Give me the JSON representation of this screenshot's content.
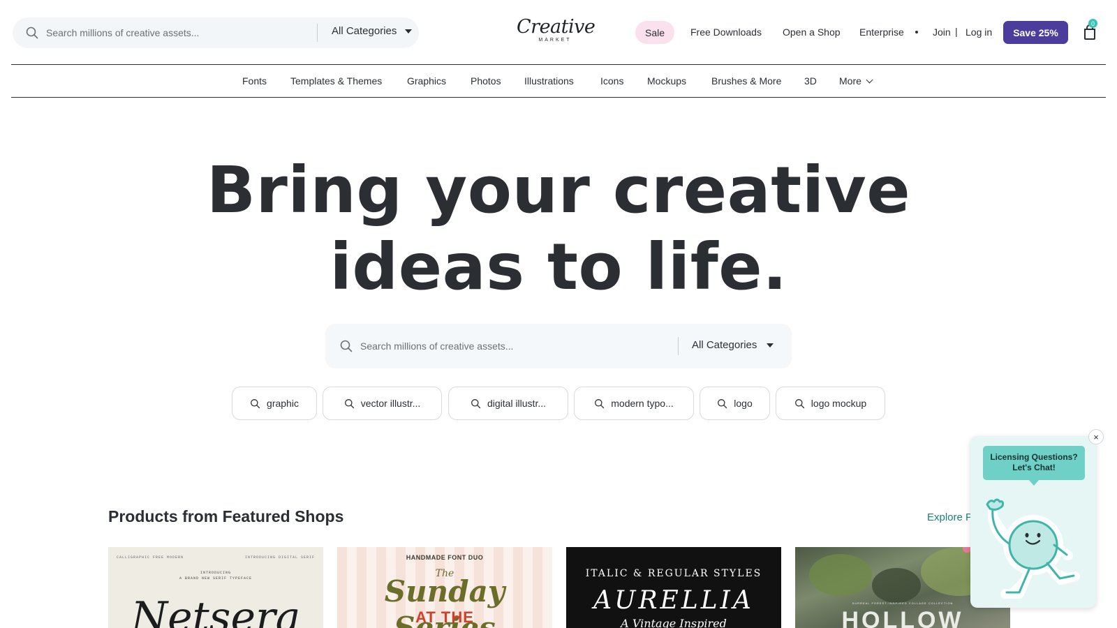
{
  "header": {
    "search_placeholder": "Search millions of creative assets...",
    "category_label": "All Categories",
    "logo_word": "Creative",
    "logo_sub": "MARKET",
    "sale": "Sale",
    "links": {
      "free_downloads": "Free Downloads",
      "open_shop": "Open a Shop",
      "enterprise": "Enterprise",
      "join": "Join",
      "separator": "|",
      "login": "Log in"
    },
    "save_button": "Save 25%",
    "cart_count": "0",
    "icons": [
      "search-icon",
      "caret-down-icon",
      "cart-icon"
    ]
  },
  "category_nav": {
    "items": [
      "Fonts",
      "Templates & Themes",
      "Graphics",
      "Photos",
      "Illustrations",
      "Icons",
      "Mockups",
      "Brushes & More",
      "3D",
      "More"
    ]
  },
  "hero": {
    "title_line1": "Bring your creative",
    "title_line2": "ideas to life.",
    "search_placeholder": "Search millions of creative assets...",
    "category_label": "All Categories",
    "chips": [
      "graphic",
      "vector illustr...",
      "digital illustr...",
      "modern typo...",
      "logo",
      "logo mockup"
    ]
  },
  "featured": {
    "title": "Products from Featured Shops",
    "explore_link": "Explore P",
    "cards": [
      {
        "small_left": "CALLIGRAPHIC FREE MODERN",
        "small_right": "INTRODUCING DIGITAL SERIF",
        "line1": "INTRODUCING",
        "line2": "A BRAND NEW SERIF TYPEFACE",
        "title": "Netsera"
      },
      {
        "top": "HANDMADE FONT DUO",
        "the": "The",
        "title": "Sunday Series",
        "sub": "AT THE"
      },
      {
        "top": "ITALIC & REGULAR STYLES",
        "title": "AURELLIA",
        "sub": "A Vintage Inspired"
      },
      {
        "small": "SURREAL FOREST-INSPIRED COLLAGE COLLECTION",
        "title": "HOLLOW"
      }
    ]
  },
  "chat": {
    "bubble_line1": "Licensing Questions?",
    "bubble_line2": "Let's Chat!",
    "close": "×"
  },
  "colors": {
    "brand_purple": "#4c3c9c",
    "sale_pink": "#fbe0ee",
    "teal_link": "#1b7f79",
    "chat_teal": "#6ed0c6",
    "text_dark": "#2b2f33"
  }
}
